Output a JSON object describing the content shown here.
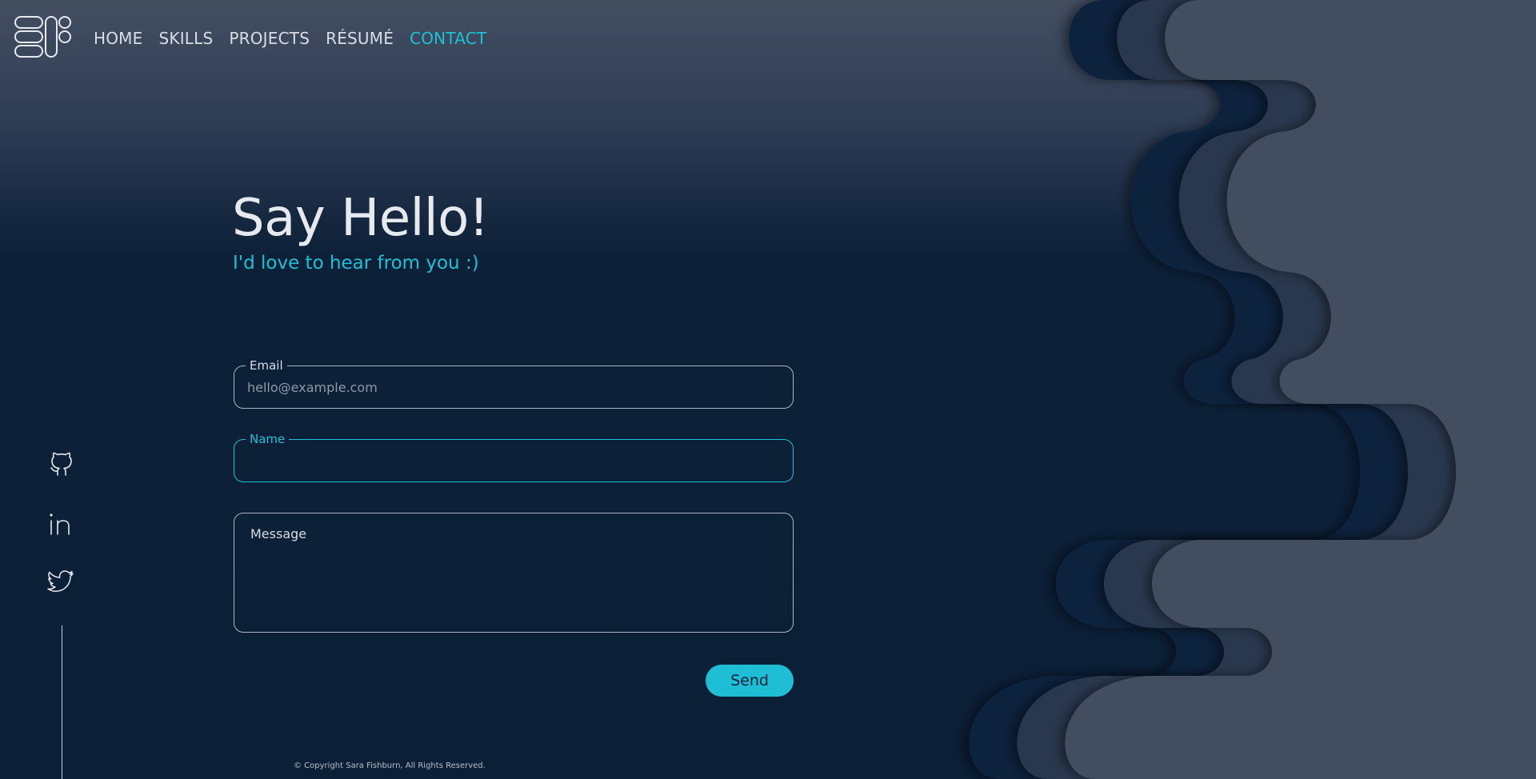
{
  "nav": {
    "items": [
      {
        "label": "HOME"
      },
      {
        "label": "SKILLS"
      },
      {
        "label": "PROJECTS"
      },
      {
        "label": "RÉSUMÉ"
      },
      {
        "label": "CONTACT",
        "active": true
      }
    ]
  },
  "hero": {
    "title": "Say Hello!",
    "subtitle": "I'd love to hear from you :)"
  },
  "form": {
    "email": {
      "label": "Email",
      "placeholder": "hello@example.com",
      "value": ""
    },
    "name": {
      "label": "Name",
      "value": "",
      "focused": true
    },
    "message": {
      "placeholder": "Message",
      "value": ""
    },
    "send_label": "Send"
  },
  "social": [
    "github-icon",
    "linkedin-icon",
    "twitter-icon"
  ],
  "footer": {
    "copyright": "© Copyright Sara Fishburn, All Rights Reserved."
  },
  "colors": {
    "accent": "#1ec0d6",
    "background": "#0b1f37",
    "wave_light": "#434e61",
    "wave_mid": "#2b3850"
  }
}
